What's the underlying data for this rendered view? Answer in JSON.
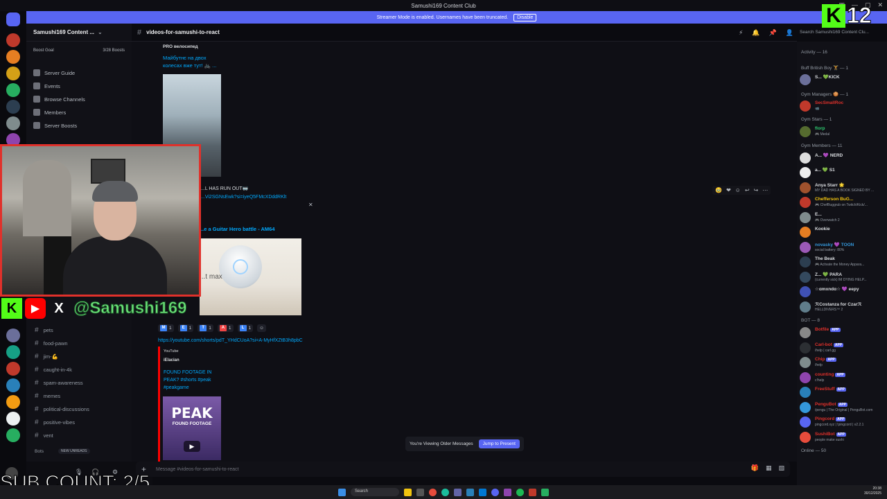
{
  "window": {
    "title": "Samushi169 Content Club"
  },
  "banner": {
    "text": "Streamer Mode is enabled. Usernames have been truncated.",
    "button": "Disable"
  },
  "server": {
    "name": "Samushi169 Content ...",
    "boost_goal": "Boost Goal",
    "boost_count": "3/28 Boosts",
    "menu": [
      "Server Guide",
      "Events",
      "Browse Channels",
      "Members",
      "Server Boosts"
    ],
    "channels": [
      "pets",
      "food-pawn",
      "jim-💪",
      "caught-in-4k",
      "spam-awareness",
      "memes",
      "political-discussions",
      "positive-vibes",
      "vent"
    ],
    "bots_label": "Bots",
    "new_unreads": "NEW UNREADS"
  },
  "channel": {
    "name": "videos-for-samushi-to-react",
    "search_placeholder": "Search Samushi169 Content Clu..."
  },
  "messages": {
    "embed1_author": "PRO велосипед",
    "embed1_title": "Майбутнє на двох колесах вже тут! 🚲 ...",
    "line2": "...L HAS RUN OUT🥽",
    "link2": "...Vi2SGNsEwk?si=iyeQ5FMcXDddRKlt",
    "embed2_title": "...e a Guitar Hero battle - AM64",
    "speaker_caption": "...t max",
    "reactions": [
      {
        "letter": "M",
        "count": "1",
        "color": "#3b82f6"
      },
      {
        "letter": "E",
        "count": "1",
        "color": "#3b82f6"
      },
      {
        "letter": "T",
        "count": "1",
        "color": "#3b82f6"
      },
      {
        "letter": "A",
        "count": "1",
        "color": "#ef4444"
      },
      {
        "letter": "L",
        "count": "1",
        "color": "#3b82f6"
      }
    ],
    "link3": "https://youtube.com/shorts/pdT_YHdCUoA?si=A-MyHfXZtB3h8pbC",
    "yt_provider": "YouTube",
    "yt_author": "iElacian",
    "yt_title": "FOUND FOOTAGE IN PEAK? #shorts #peak #peakgame",
    "peak_title": "PEAK",
    "peak_sub": "FOUND FOOTAGE",
    "older_text": "You're Viewing Older Messages",
    "jump_button": "Jump to Present"
  },
  "composer": {
    "placeholder": "Message #videos-for-samushi-to-react"
  },
  "members": {
    "activity": "Activity — 16",
    "groups": [
      {
        "header": "Buff British Boy 🏋️ — 1",
        "members": [
          {
            "name": "S... 💚KICK",
            "status": "",
            "color": "#dbdee1",
            "avatar": "#6b6f9a"
          }
        ]
      },
      {
        "header": "Gym Managers 🍪 — 1",
        "members": [
          {
            "name": "SecSmallRoc",
            "status": "📹",
            "color": "#e0312b",
            "avatar": "#c0392b"
          }
        ]
      },
      {
        "header": "Gym Stars — 1",
        "members": [
          {
            "name": "florp",
            "status": "🎮 Medal",
            "color": "#2ecc71",
            "avatar": "#556b2f"
          }
        ]
      },
      {
        "header": "Gym Members — 11",
        "members": [
          {
            "name": "A... 💜 NERD",
            "status": "",
            "color": "#dbdee1",
            "avatar": "#ddd"
          },
          {
            "name": "a... 💚 S1",
            "status": "",
            "color": "#dbdee1",
            "avatar": "#eee"
          },
          {
            "name": "Anya Starr 🌟",
            "status": "MY DAD HAS A BOOK SIGNED BY ...",
            "color": "#dbdee1",
            "avatar": "#a0522d"
          },
          {
            "name": "Chefferson BuG...",
            "status": "🎮 ChefBuggrub on Twitch/Kick/...",
            "color": "#f1c40f",
            "avatar": "#c0392b"
          },
          {
            "name": "E...",
            "status": "🎮 Overwatch 2",
            "color": "#dbdee1",
            "avatar": "#7f8c8d"
          },
          {
            "name": "Kookie",
            "status": "",
            "color": "#dbdee1",
            "avatar": "#e67e22"
          },
          {
            "name": "novasky 💜 TOON",
            "status": "social battery: 80%",
            "color": "#3498db",
            "avatar": "#9b59b6"
          },
          {
            "name": "The Beak",
            "status": "🎮 Activate the Money Appara...",
            "color": "#dbdee1",
            "avatar": "#2c3e50"
          },
          {
            "name": "Z... 💚 PARA",
            "status": "(currently sick) IM DYING HELP...",
            "color": "#dbdee1",
            "avatar": "#34495e"
          },
          {
            "name": "☆ɑmxndɑ☆ 💜 eepy",
            "status": "",
            "color": "#dbdee1",
            "avatar": "#3f51b5"
          },
          {
            "name": "ℛCostanza for Czarℛ",
            "status": "HELLDIVERS™ 2",
            "color": "#dbdee1",
            "avatar": "#607d8b"
          }
        ]
      },
      {
        "header": "BOT — 8",
        "members": [
          {
            "name": "Botfile",
            "status": "",
            "color": "#e0312b",
            "avatar": "#888",
            "app": "APP"
          },
          {
            "name": "Carl-bot",
            "status": "/help | carl.gg",
            "color": "#e0312b",
            "avatar": "#2c2f33",
            "app": "APP"
          },
          {
            "name": "Chip",
            "status": "/help",
            "color": "#e0312b",
            "avatar": "#7f8c8d",
            "app": "APP"
          },
          {
            "name": "counting",
            "status": "c!help",
            "color": "#e0312b",
            "avatar": "#8e44ad",
            "app": "APP"
          },
          {
            "name": "FreeStuff",
            "status": "",
            "color": "#e0312b",
            "avatar": "#2980b9",
            "app": "APP"
          },
          {
            "name": "PenguBot",
            "status": "/pengu | The Original | PenguBot.com",
            "color": "#e0312b",
            "avatar": "#3498db",
            "app": "APP"
          },
          {
            "name": "Pingcord",
            "status": "pingcord.xyz | !pingcord | v2.2.1",
            "color": "#e0312b",
            "avatar": "#5865f2",
            "app": "APP"
          },
          {
            "name": "SushiBot",
            "status": "people make sushi",
            "color": "#e0312b",
            "avatar": "#e74c3c",
            "app": "APP"
          }
        ]
      }
    ],
    "online": "Online — 50"
  },
  "overlay": {
    "handle": "@Samushi169",
    "sub_count": "SUB COUNT: 2/5",
    "k12_label": "K",
    "k12_num": "12"
  },
  "taskbar": {
    "search": "Search",
    "time": "20:38",
    "date": "30/12/2025"
  }
}
